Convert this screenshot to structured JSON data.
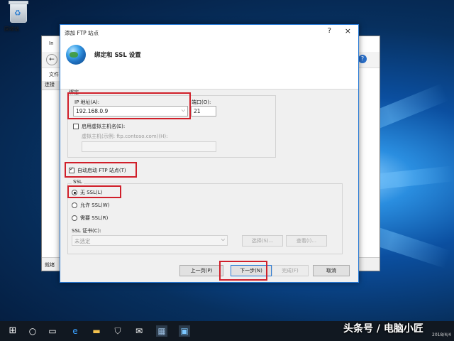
{
  "desktop": {
    "recycle_bin_label": "回收站"
  },
  "background_window": {
    "title_prefix": "In",
    "menu_file": "文件",
    "left_header": "连接",
    "status_ready": "就绪"
  },
  "dialog": {
    "title": "添加 FTP 站点",
    "help": "?",
    "close": "×",
    "header_title": "绑定和 SSL 设置",
    "binding": {
      "group_label": "绑定",
      "ip_label": "IP 地址(A):",
      "ip_value": "192.168.0.9",
      "port_label": "端口(O):",
      "port_value": "21",
      "virtual_host_label": "启用虚拟主机名(E):",
      "virtual_host_hint": "虚拟主机(示例: ftp.contoso.com)(H):",
      "virtual_host_value": ""
    },
    "autostart_label": "自动启动 FTP 站点(T)",
    "autostart_checked": true,
    "ssl": {
      "group_label": "SSL",
      "options": [
        "无 SSL(L)",
        "允许 SSL(W)",
        "需要 SSL(R)"
      ],
      "selected_index": 0,
      "cert_label": "SSL 证书(C):",
      "cert_value": "未选定",
      "select_button": "选择(S)...",
      "view_button": "查看(I)..."
    },
    "buttons": {
      "previous": "上一页(P)",
      "next": "下一步(N)",
      "finish": "完成(F)",
      "cancel": "取消"
    }
  },
  "taskbar": {
    "date": "2018/4/4"
  },
  "watermark": "头条号 / 电脑小匠"
}
